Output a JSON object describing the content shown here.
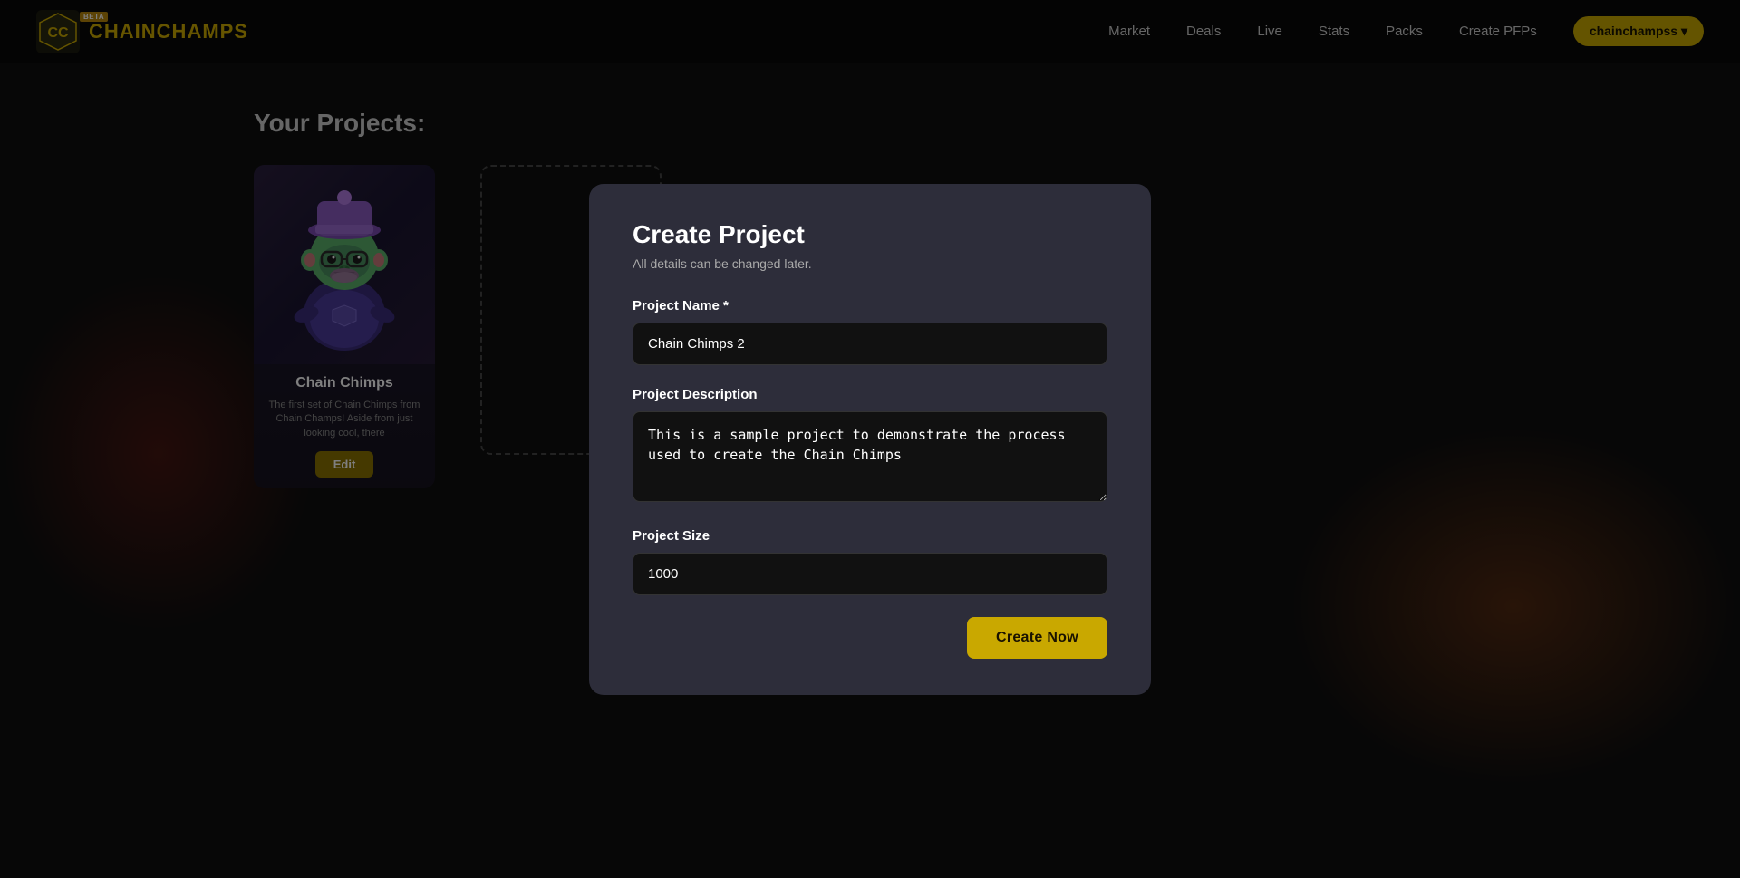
{
  "brand": {
    "name_chain": "CHAIN",
    "name_champs": "CHAMPS",
    "beta_label": "BETA"
  },
  "navbar": {
    "links": [
      {
        "label": "Market",
        "key": "market"
      },
      {
        "label": "Deals",
        "key": "deals"
      },
      {
        "label": "Live",
        "key": "live"
      },
      {
        "label": "Stats",
        "key": "stats"
      },
      {
        "label": "Packs",
        "key": "packs"
      },
      {
        "label": "Create PFPs",
        "key": "create-pfps"
      }
    ],
    "user_button": "chainchampss ▾"
  },
  "page": {
    "title": "Your Projects:"
  },
  "project_card": {
    "title": "Chain Chimps",
    "description": "The first set of Chain Chimps from Chain Champs! Aside from just looking cool, there",
    "edit_label": "Edit"
  },
  "modal": {
    "title": "Create Project",
    "subtitle": "All details can be changed later.",
    "project_name_label": "Project Name *",
    "project_name_value": "Chain Chimps 2",
    "project_description_label": "Project Description",
    "project_description_value": "This is a sample project to demonstrate the process used to create the Chain Chimps",
    "project_size_label": "Project Size",
    "project_size_value": "1000",
    "create_button": "Create Now"
  }
}
